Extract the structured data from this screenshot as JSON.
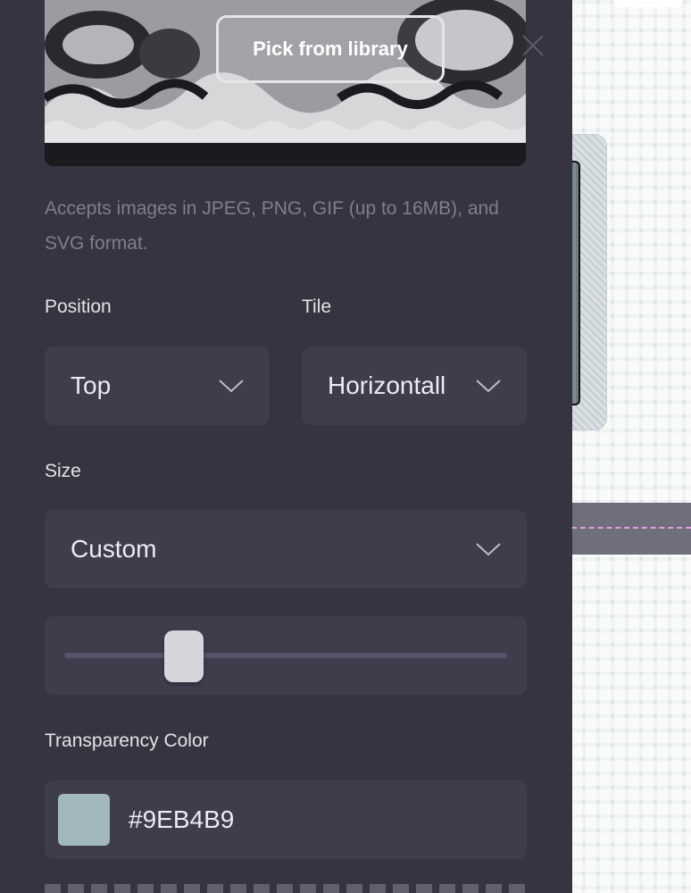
{
  "preview": {
    "pick_button_label": "Pick from library"
  },
  "help_text": "Accepts images in JPEG, PNG, GIF (up to 16MB), and SVG format.",
  "position": {
    "label": "Position",
    "value": "Top"
  },
  "tile": {
    "label": "Tile",
    "value": "Horizontall"
  },
  "size": {
    "label": "Size",
    "value": "Custom",
    "slider_fraction": 0.27
  },
  "transparency": {
    "label": "Transparency Color",
    "value": "#9EB4B9",
    "swatch_color": "#a3b8bc"
  },
  "colors": {
    "panel": "#353440",
    "field": "#3e3d4b",
    "help_text": "#7f7e8c"
  },
  "icons": [
    "close-icon",
    "chevron-down-icon"
  ]
}
